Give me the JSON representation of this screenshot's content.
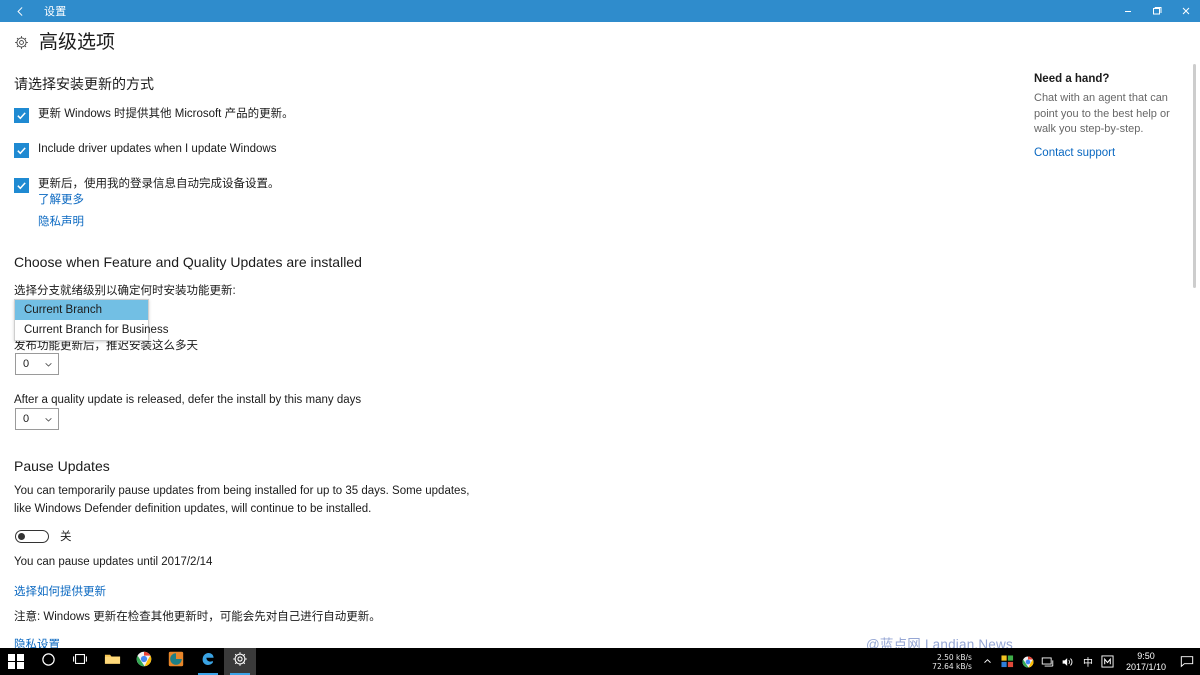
{
  "titlebar": {
    "back_icon": "back-arrow-icon",
    "title": "设置",
    "minimize_label": "最小化",
    "restore_label": "还原",
    "close_label": "关闭",
    "accent_color": "#2f8ccc"
  },
  "header": {
    "gear_icon": "gear-icon",
    "title": "高级选项"
  },
  "main": {
    "section1_heading": "请选择安装更新的方式",
    "checkboxes": [
      {
        "label": "更新 Windows 时提供其他 Microsoft 产品的更新。",
        "checked": true
      },
      {
        "label": "Include driver updates when I update Windows",
        "checked": true
      },
      {
        "label": "更新后，使用我的登录信息自动完成设备设置。",
        "checked": true
      }
    ],
    "learn_more_link": "了解更多",
    "privacy_statement_link": "隐私声明",
    "section2_heading": "Choose when Feature and Quality Updates are installed",
    "branch_label": "选择分支就绪级别以确定何时安装功能更新:",
    "branch_options": [
      "Current Branch",
      "Current Branch for Business"
    ],
    "branch_selected": "Current Branch",
    "feature_defer_label": "发布功能更新后，推迟安装这么多天",
    "feature_defer_value": "0",
    "quality_defer_label": "After a quality update is released, defer the install by this many days",
    "quality_defer_value": "0",
    "section3_heading": "Pause Updates",
    "pause_description": "You can temporarily pause updates from being installed for up to 35 days. Some updates, like Windows Defender definition updates, will continue to be installed.",
    "pause_toggle_state": "关",
    "pause_until_text": "You can pause updates until 2017/2/14",
    "delivery_link": "选择如何提供更新",
    "note_text": "注意: Windows 更新在检查其他更新时，可能会先对自己进行自动更新。",
    "privacy_settings_link": "隐私设置"
  },
  "help": {
    "title": "Need a hand?",
    "text": "Chat with an agent that can point you to the best help or walk you step-by-step.",
    "contact_link": "Contact support"
  },
  "watermark": "@蓝点网 Landian.News",
  "taskbar": {
    "items": [
      {
        "name": "start-button",
        "icon": "windows-logo-icon"
      },
      {
        "name": "cortana-button",
        "icon": "circle-icon"
      },
      {
        "name": "task-view-button",
        "icon": "task-view-icon"
      },
      {
        "name": "file-explorer-button",
        "icon": "folder-icon"
      },
      {
        "name": "chrome-button",
        "icon": "chrome-icon"
      },
      {
        "name": "app-button",
        "icon": "app-icon"
      },
      {
        "name": "edge-button",
        "icon": "edge-icon"
      },
      {
        "name": "settings-button",
        "icon": "gear-icon"
      }
    ],
    "tray": {
      "net_down": "2.50 kB/s",
      "net_up": "72.64 kB/s",
      "show_hidden_icon": "chevron-up-icon",
      "icons": [
        "colorful-app-icon",
        "chrome-icon",
        "network-icon",
        "volume-icon",
        "ime-chinese-icon",
        "m-app-icon"
      ],
      "ime_label": "中",
      "m_label": "M",
      "time": "9:50",
      "date": "2017/1/10",
      "action_center_icon": "action-center-icon"
    }
  }
}
